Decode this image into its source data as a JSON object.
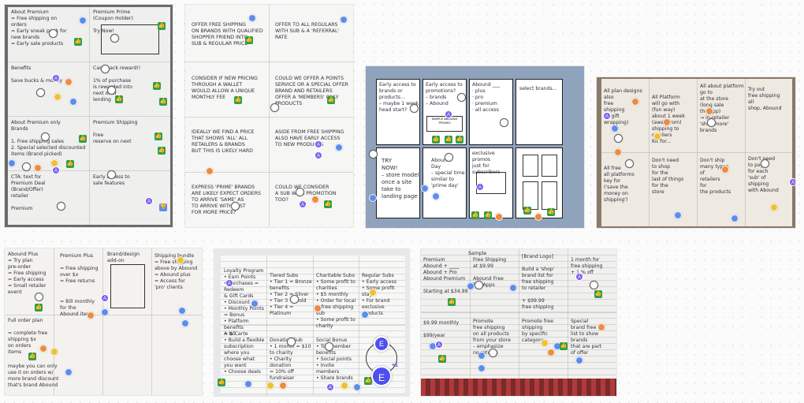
{
  "photos": {
    "p1": {
      "cells": [
        "About Premium\n= Free shipping on\n  orders\n= Early sneak peek for\n  new brands\n= Early sale products",
        "Premium Prime\n (Coupon Holder)\n\n  Try Now!",
        "Benefits\n\nSave bucks & money",
        "Cash back reward!!\n\n1% of purchase\n is rewarded into\n next offer\n lending",
        "About Premium only\n  Brands\n\n1. Free shipping sales\n2. Special selected discounted\n   items (Brand picked)",
        "Premium Shipping\n\n  Free\n  reserve on next",
        "CTA: text for\n  Premium Deal\n  (Brand/Offer)\n  retailer\n\n  Premium",
        "Early access to\n  sale features"
      ],
      "caption": "Save bucks & money"
    },
    "p2": {
      "cells": [
        "OFFER FREE SHIPPING\nON BRANDS WITH QUALIFIED\nSHOPPER FRIEND INTO\nSUB & REGULAR PRICE",
        "OFFER TO ALL REGULARS\nWITH SUB & A 'REFERRAL'\nRATE",
        "CONSIDER IF NEW PRICING\nTHROUGH A WALLET\nWOULD ALLOW A UNIQUE\nMONTHLY FEE",
        "COULD WE OFFER A POINTS\nSERVICE OR A SPECIAL OFFER\nBRAND AND RETAILERS\nOFFER A 'MEMBERS' ONLY\nPRODUCTS",
        "IDEALLY WE FIND A PRICE\nTHAT SHOWS 'ALL' ALL\nRETAILERS & BRANDS\nBUT THIS IS LIKELY HARD",
        "ASIDE FROM FREE SHIPPING\nALSO HAVE EARLY ACCESS\nTO NEW PRODUCTS",
        "EXPRESS 'PRIME' BRANDS\nARE LIKELY EXPECT ORDERS\nTO ARRIVE 'SAME' AS\nTO ARRIVE WITH FAST\nFOR MORE PRICE?",
        "COULD WE CONSIDER\nA SUB WITH PROMOTION TOO?"
      ]
    },
    "p3": {
      "cells": [
        "Early access to\nbrands or\nproducts...\n– maybe 1 week\n  head start?",
        "Early access to\npromotions?\n– brands\n– Abound",
        "Abound ___\n· plus\n· pro\n· premium\n· all access",
        "select brands...",
        "TRY\nNOW!\n– store model\n  once a site\n  take to\n  landing page",
        "Abound\nDay\n– special time\n  similar to\n  'prime day'",
        "exclusive promos\njust for subscribers",
        ""
      ],
      "sub_label": "SIMPLE ABOUND PROMO"
    },
    "p4": {
      "cells": [
        "All plan designs\n  also\nfree\nshipping\n  (+ gift\n  wrapping)",
        "All Platform\nwill go with\n(fun way)\nabout 1 week\n(away from)\nshipping to\nretailers\n  Kit for...",
        "All about platform\ngo to\nat the store\n(long sale\nthe app)\n→ in-retailer\n  'shop more'\n  brands",
        "Try out\nfree shipping\nall\nshop, Abound",
        "All free\nall platforms\nkey for\n('save the\n money on\n shipping')",
        "Don't need\nto shop\nfor the\nlast of things\nfor the\nstore",
        "Don't ship\nmany types\nof\nretailers\nfor\nthe products",
        "Don't need\nto pay\nfor each\n'sub' of\nshipping\nwith Abound"
      ]
    },
    "p5": {
      "cells": [
        "Abound Plus\n= Try plan\n  pre-order\n= Free shipping\n= Early access\n= Small retailer\n  event",
        "Premium Plus\n\n= Free shipping\n  over $x\n= Free returns",
        "Brand/design\nadd-on",
        "Shipping bundle\n= Free shipping\n  above by Abound\n= Abound plus\n= Access for\n  'pro' clients",
        "Full order plan\n\n= complete free\n  shipping $x\n  on orders\n  items",
        "= Bill monthly\n  for the\n  Abound items",
        "maybe you can only\nuse it on orders w/\nmore brand discount\nthat's brand Abound"
      ]
    },
    "p6": {
      "cells": [
        "Loyalty Program\n• Earn Points\n• Purchases = Redeem\n  & Gift Cards\n• Discount\n• Monthly Points\n  = Bonus\n• Platform benefits\n  = $5",
        "Tiered Subs\n• Tier 1 = Bronze\n  benefits\n• Tier 2 = Silver\n• Tier 3 = Gold\n• Tier 4 = Platinum",
        "Charitable Subs\n• Some profit to\n  charities\n• $5 monthly\n• Order for local\n  & free shipping\n  sub\n• Some profit to\n  charity",
        "Regular Subs\n• Early access\n• Some profit\n  stays\n• For brand\n  exclusive\n  products",
        "A la Carte\n• Build a flexible\n  subscription\n  where you\n  choose what\n  you want\n• Choose deals",
        "Donation Sub\n• 1 month = $10\n  to charity\n• Charity donation\n  = 10% off\n  fundraiser",
        "Social Bonus\n• Top member\n  benefits\n• Social points\n• Invite members\n• Share brands",
        ""
      ],
      "big_avatar": "E",
      "plus_badge": "+1"
    },
    "p7": {
      "cells": [
        "Premium\nAbound + ____\nAbound + Pro\nAbound Premium\n\nStarting at $34.99",
        "Free Shipping\nat $9.99\n\nAbound Free\nTag Apps",
        "[Brand Logo]\n\nBuild a 'shop'\nbrand list for\nfree shipping\nto retailer\n\n+ $99.99\nfree shipping",
        "1 month for\nfree shipping\n+ 1 % off",
        "$9.99 monthly\n\n$99/year",
        "Promote\nfree shipping\non all products\nfrom your store\n– emphasize\nno returns",
        "Promote free shipping\nby specific category",
        "Special\nbrand free\nlist to show\nbrands\nthat are part\nof offer"
      ],
      "header": "Sample"
    }
  }
}
